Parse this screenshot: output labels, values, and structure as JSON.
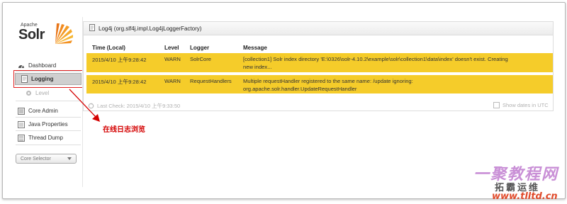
{
  "brand": {
    "apache": "Apache",
    "solr": "Solr"
  },
  "sidebar": {
    "items": [
      {
        "label": "Dashboard",
        "icon": "dashboard-icon"
      },
      {
        "label": "Logging",
        "icon": "log-document-icon",
        "active": true
      },
      {
        "label": "Level",
        "icon": "level-gear-icon",
        "sub": true
      },
      {
        "label": "Core Admin",
        "icon": "core-admin-icon"
      },
      {
        "label": "Java Properties",
        "icon": "java-properties-icon"
      },
      {
        "label": "Thread Dump",
        "icon": "thread-dump-icon"
      }
    ],
    "core_selector": "Core Selector"
  },
  "panel": {
    "title": "Log4j (org.slf4j.impl.Log4jLoggerFactory)",
    "columns": [
      "Time (Local)",
      "Level",
      "Logger",
      "Message"
    ],
    "rows": [
      {
        "time": "2015/4/10 上午9:28:42",
        "level": "WARN",
        "logger": "SolrCore",
        "message_line1": "[collection1] Solr index directory 'E:\\0326\\solr-4.10.2\\example\\solr\\collection1\\data\\index' doesn't exist. Creating",
        "message_line2": "new index..."
      },
      {
        "time": "2015/4/10 上午9:28:42",
        "level": "WARN",
        "logger": "RequestHandlers",
        "message_line1": "Multiple requestHandler registered to the same name: /update ignoring:",
        "message_line2": "org.apache.solr.handler.UpdateRequestHandler"
      }
    ]
  },
  "footer": {
    "last_check": "Last Check: 2015/4/10 上午9:33:50",
    "show_dates": "Show dates in UTC"
  },
  "annotation": "在线日志浏览",
  "watermark": {
    "cn": "一聚教程网",
    "cn2": "拓霸运维",
    "url": "www.tlltd.cn"
  },
  "colors": {
    "warn_row": "#f5cc2a",
    "annotation_red": "#d40000",
    "highlight_box": "#e02020"
  }
}
